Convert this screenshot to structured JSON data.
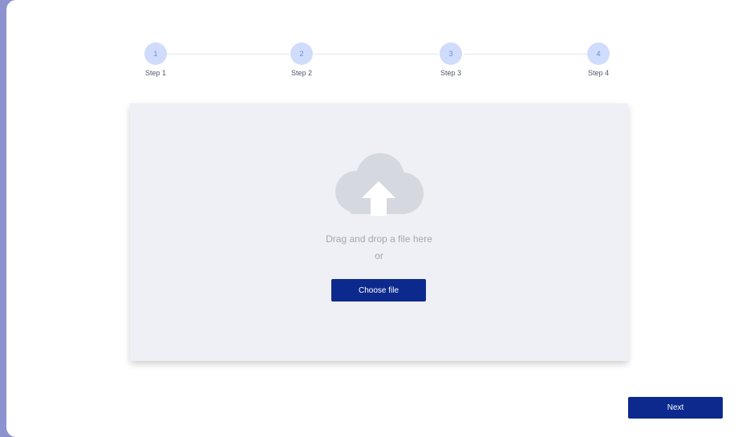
{
  "stepper": {
    "steps": [
      {
        "number": "1",
        "label": "Step 1"
      },
      {
        "number": "2",
        "label": "Step 2"
      },
      {
        "number": "3",
        "label": "Step 3"
      },
      {
        "number": "4",
        "label": "Step 4"
      }
    ]
  },
  "upload": {
    "icon": "cloud-upload-icon",
    "instruction": "Drag and drop a file here",
    "separator": "or",
    "choose_label": "Choose file"
  },
  "footer": {
    "next_label": "Next"
  },
  "colors": {
    "primary": "#0c2a8e",
    "step_circle": "#cfdcfb",
    "step_number": "#6a8de6",
    "dropzone_bg": "#eff0f5",
    "icon": "#d6d8e0",
    "sidebar_bg": "#8c93cf"
  }
}
